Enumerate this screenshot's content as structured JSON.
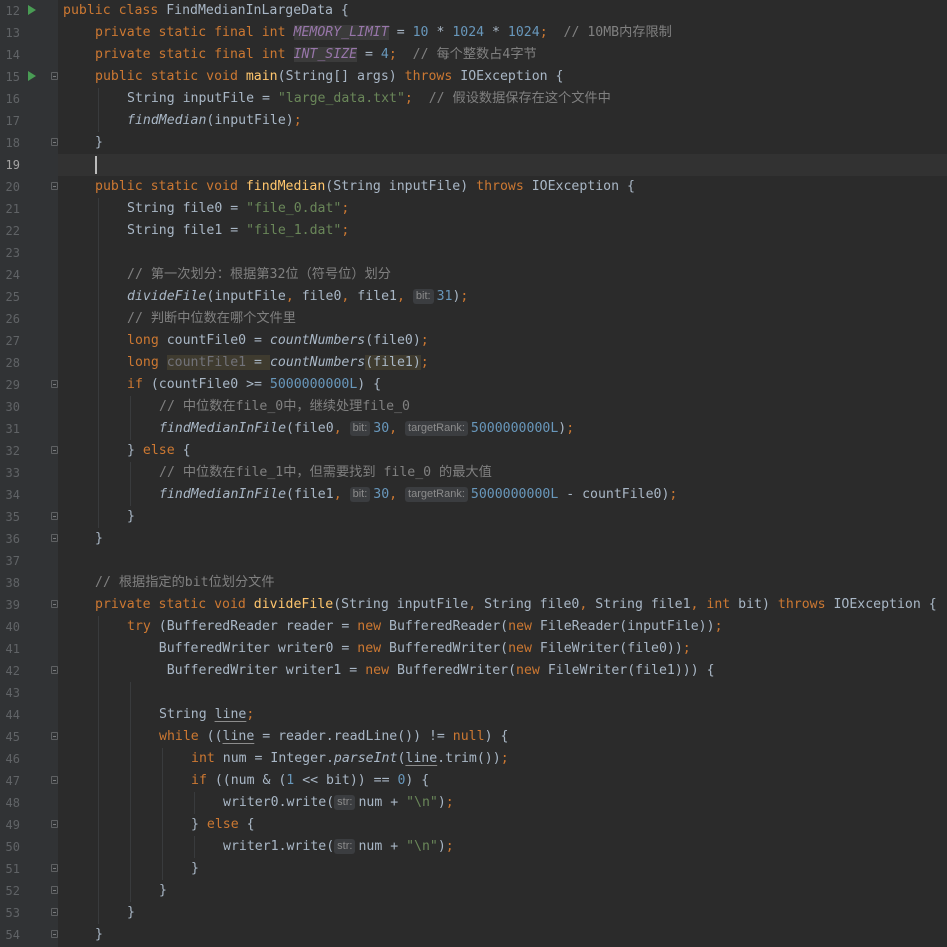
{
  "editor": {
    "language": "java",
    "current_line": 19,
    "colors": {
      "background": "#2b2b2b",
      "gutter": "#313335",
      "keyword": "#cc7832",
      "string": "#6a8759",
      "number": "#6897bb",
      "comment": "#808080",
      "constant": "#9876aa",
      "method_declaration": "#ffc66d",
      "run_icon": "#499c54"
    },
    "lines": [
      {
        "no": "12",
        "run": true,
        "fold": false,
        "indent": 0,
        "tokens": [
          [
            "kw",
            "public class "
          ],
          [
            "p",
            "FindMedianInLargeData {"
          ]
        ]
      },
      {
        "no": "13",
        "indent": 1,
        "tokens": [
          [
            "kw",
            "private static final int "
          ],
          [
            "const",
            "MEMORY_LIMIT"
          ],
          [
            "p",
            " = "
          ],
          [
            "num",
            "10"
          ],
          [
            "p",
            " * "
          ],
          [
            "num",
            "1024"
          ],
          [
            "p",
            " * "
          ],
          [
            "num",
            "1024"
          ],
          [
            "kw",
            ";"
          ],
          [
            "cmt",
            "  // 10MB内存限制"
          ]
        ]
      },
      {
        "no": "14",
        "indent": 1,
        "tokens": [
          [
            "kw",
            "private static final int "
          ],
          [
            "const",
            "INT_SIZE"
          ],
          [
            "p",
            " = "
          ],
          [
            "num",
            "4"
          ],
          [
            "kw",
            ";"
          ],
          [
            "cmt",
            "  // 每个整数占4字节"
          ]
        ]
      },
      {
        "no": "15",
        "run": true,
        "fold": true,
        "indent": 1,
        "tokens": [
          [
            "kw",
            "public static void "
          ],
          [
            "fn",
            "main"
          ],
          [
            "p",
            "(String[] args) "
          ],
          [
            "kw",
            "throws "
          ],
          [
            "p",
            "IOException {"
          ]
        ]
      },
      {
        "no": "16",
        "indent": 2,
        "tokens": [
          [
            "p",
            "String inputFile = "
          ],
          [
            "str",
            "\"large_data.txt\""
          ],
          [
            "kw",
            ";"
          ],
          [
            "cmt",
            "  // 假设数据保存在这个文件中"
          ]
        ]
      },
      {
        "no": "17",
        "indent": 2,
        "tokens": [
          [
            "sfn",
            "findMedian"
          ],
          [
            "p",
            "(inputFile)"
          ],
          [
            "kw",
            ";"
          ]
        ]
      },
      {
        "no": "18",
        "fold": true,
        "indent": 1,
        "tokens": [
          [
            "p",
            "}"
          ]
        ]
      },
      {
        "no": "19",
        "indent": 1,
        "caret": true,
        "tokens": []
      },
      {
        "no": "20",
        "fold": true,
        "indent": 1,
        "tokens": [
          [
            "kw",
            "public static void "
          ],
          [
            "fn",
            "findMedian"
          ],
          [
            "p",
            "(String inputFile) "
          ],
          [
            "kw",
            "throws "
          ],
          [
            "p",
            "IOException {"
          ]
        ]
      },
      {
        "no": "21",
        "indent": 2,
        "tokens": [
          [
            "p",
            "String file0 = "
          ],
          [
            "str",
            "\"file_0.dat\""
          ],
          [
            "kw",
            ";"
          ]
        ]
      },
      {
        "no": "22",
        "indent": 2,
        "tokens": [
          [
            "p",
            "String file1 = "
          ],
          [
            "str",
            "\"file_1.dat\""
          ],
          [
            "kw",
            ";"
          ]
        ]
      },
      {
        "no": "23",
        "indent": 2,
        "tokens": []
      },
      {
        "no": "24",
        "indent": 2,
        "tokens": [
          [
            "cmt",
            "// 第一次划分：根据第32位（符号位）划分"
          ]
        ]
      },
      {
        "no": "25",
        "indent": 2,
        "tokens": [
          [
            "sfn",
            "divideFile"
          ],
          [
            "p",
            "(inputFile"
          ],
          [
            "kw",
            ", "
          ],
          [
            "p",
            "file0"
          ],
          [
            "kw",
            ", "
          ],
          [
            "p",
            "file1"
          ],
          [
            "kw",
            ", "
          ],
          [
            "hint",
            "bit:"
          ],
          [
            "num",
            "31"
          ],
          [
            "p",
            ")"
          ],
          [
            "kw",
            ";"
          ]
        ]
      },
      {
        "no": "26",
        "indent": 2,
        "tokens": [
          [
            "cmt",
            "// 判断中位数在哪个文件里"
          ]
        ]
      },
      {
        "no": "27",
        "indent": 2,
        "tokens": [
          [
            "kw",
            "long "
          ],
          [
            "p",
            "countFile0 = "
          ],
          [
            "sfn",
            "countNumbers"
          ],
          [
            "p",
            "(file0)"
          ],
          [
            "kw",
            ";"
          ]
        ]
      },
      {
        "no": "28",
        "indent": 2,
        "tokens": [
          [
            "kw",
            "long "
          ],
          [
            "unused",
            "countFile1"
          ],
          [
            "warn",
            " = "
          ],
          [
            "sfn",
            "countNumbers"
          ],
          [
            "warn",
            "(file1)"
          ],
          [
            "kw",
            ";"
          ]
        ]
      },
      {
        "no": "29",
        "fold": true,
        "indent": 2,
        "tokens": [
          [
            "kw",
            "if "
          ],
          [
            "p",
            "(countFile0 >= "
          ],
          [
            "num",
            "5000000000L"
          ],
          [
            "p",
            ") {"
          ]
        ]
      },
      {
        "no": "30",
        "indent": 3,
        "tokens": [
          [
            "cmt",
            "// 中位数在file_0中，继续处理file_0"
          ]
        ]
      },
      {
        "no": "31",
        "indent": 3,
        "tokens": [
          [
            "sfn",
            "findMedianInFile"
          ],
          [
            "p",
            "(file0"
          ],
          [
            "kw",
            ", "
          ],
          [
            "hint",
            "bit:"
          ],
          [
            "num",
            "30"
          ],
          [
            "kw",
            ", "
          ],
          [
            "hint",
            "targetRank:"
          ],
          [
            "num",
            "5000000000L"
          ],
          [
            "p",
            ")"
          ],
          [
            "kw",
            ";"
          ]
        ]
      },
      {
        "no": "32",
        "fold": true,
        "indent": 2,
        "tokens": [
          [
            "p",
            "} "
          ],
          [
            "kw",
            "else "
          ],
          [
            "p",
            "{"
          ]
        ]
      },
      {
        "no": "33",
        "indent": 3,
        "tokens": [
          [
            "cmt",
            "// 中位数在file_1中，但需要找到 file_0 的最大值"
          ]
        ]
      },
      {
        "no": "34",
        "indent": 3,
        "tokens": [
          [
            "sfn",
            "findMedianInFile"
          ],
          [
            "p",
            "(file1"
          ],
          [
            "kw",
            ", "
          ],
          [
            "hint",
            "bit:"
          ],
          [
            "num",
            "30"
          ],
          [
            "kw",
            ", "
          ],
          [
            "hint",
            "targetRank:"
          ],
          [
            "num",
            "5000000000L"
          ],
          [
            "p",
            " - countFile0)"
          ],
          [
            "kw",
            ";"
          ]
        ]
      },
      {
        "no": "35",
        "fold": true,
        "indent": 2,
        "tokens": [
          [
            "p",
            "}"
          ]
        ]
      },
      {
        "no": "36",
        "fold": true,
        "indent": 1,
        "tokens": [
          [
            "p",
            "}"
          ]
        ]
      },
      {
        "no": "37",
        "indent": 1,
        "tokens": []
      },
      {
        "no": "38",
        "indent": 1,
        "tokens": [
          [
            "cmt",
            "// 根据指定的bit位划分文件"
          ]
        ]
      },
      {
        "no": "39",
        "fold": true,
        "indent": 1,
        "tokens": [
          [
            "kw",
            "private static void "
          ],
          [
            "fn",
            "divideFile"
          ],
          [
            "p",
            "(String inputFile"
          ],
          [
            "kw",
            ", "
          ],
          [
            "p",
            "String file0"
          ],
          [
            "kw",
            ", "
          ],
          [
            "p",
            "String file1"
          ],
          [
            "kw",
            ", int "
          ],
          [
            "p",
            "bit) "
          ],
          [
            "kw",
            "throws "
          ],
          [
            "p",
            "IOException {"
          ]
        ]
      },
      {
        "no": "40",
        "indent": 2,
        "tokens": [
          [
            "kw",
            "try "
          ],
          [
            "p",
            "(BufferedReader reader = "
          ],
          [
            "kw",
            "new "
          ],
          [
            "p",
            "BufferedReader("
          ],
          [
            "kw",
            "new "
          ],
          [
            "p",
            "FileReader(inputFile))"
          ],
          [
            "kw",
            ";"
          ]
        ]
      },
      {
        "no": "41",
        "indent": 2,
        "pad": " ",
        "tokens": [
          [
            "p",
            "    BufferedWriter writer0 = "
          ],
          [
            "kw",
            "new "
          ],
          [
            "p",
            "BufferedWriter("
          ],
          [
            "kw",
            "new "
          ],
          [
            "p",
            "FileWriter(file0))"
          ],
          [
            "kw",
            ";"
          ]
        ]
      },
      {
        "no": "42",
        "fold": true,
        "indent": 2,
        "tokens": [
          [
            "p",
            "     BufferedWriter writer1 = "
          ],
          [
            "kw",
            "new "
          ],
          [
            "p",
            "BufferedWriter("
          ],
          [
            "kw",
            "new "
          ],
          [
            "p",
            "FileWriter(file1))) {"
          ]
        ]
      },
      {
        "no": "43",
        "indent": 3,
        "tokens": []
      },
      {
        "no": "44",
        "indent": 3,
        "tokens": [
          [
            "p",
            "String "
          ],
          [
            "u",
            "line"
          ],
          [
            "kw",
            ";"
          ]
        ]
      },
      {
        "no": "45",
        "fold": true,
        "indent": 3,
        "tokens": [
          [
            "kw",
            "while "
          ],
          [
            "p",
            "(("
          ],
          [
            "u",
            "line"
          ],
          [
            "p",
            " = reader.readLine()) != "
          ],
          [
            "kw",
            "null"
          ],
          [
            "p",
            ") {"
          ]
        ]
      },
      {
        "no": "46",
        "indent": 4,
        "tokens": [
          [
            "kw",
            "int "
          ],
          [
            "p",
            "num = Integer."
          ],
          [
            "sfn",
            "parseInt"
          ],
          [
            "p",
            "("
          ],
          [
            "u",
            "line"
          ],
          [
            "p",
            ".trim())"
          ],
          [
            "kw",
            ";"
          ]
        ]
      },
      {
        "no": "47",
        "fold": true,
        "indent": 4,
        "tokens": [
          [
            "kw",
            "if "
          ],
          [
            "p",
            "((num & ("
          ],
          [
            "num",
            "1"
          ],
          [
            "p",
            " << bit)) == "
          ],
          [
            "num",
            "0"
          ],
          [
            "p",
            ") {"
          ]
        ]
      },
      {
        "no": "48",
        "indent": 5,
        "tokens": [
          [
            "p",
            "writer0.write("
          ],
          [
            "hint",
            "str:"
          ],
          [
            "p",
            "num + "
          ],
          [
            "str",
            "\"\\n\""
          ],
          [
            "p",
            ")"
          ],
          [
            "kw",
            ";"
          ]
        ]
      },
      {
        "no": "49",
        "fold": true,
        "indent": 4,
        "tokens": [
          [
            "p",
            "} "
          ],
          [
            "kw",
            "else "
          ],
          [
            "p",
            "{"
          ]
        ]
      },
      {
        "no": "50",
        "indent": 5,
        "tokens": [
          [
            "p",
            "writer1.write("
          ],
          [
            "hint",
            "str:"
          ],
          [
            "p",
            "num + "
          ],
          [
            "str",
            "\"\\n\""
          ],
          [
            "p",
            ")"
          ],
          [
            "kw",
            ";"
          ]
        ]
      },
      {
        "no": "51",
        "fold": true,
        "indent": 4,
        "tokens": [
          [
            "p",
            "}"
          ]
        ]
      },
      {
        "no": "52",
        "fold": true,
        "indent": 3,
        "tokens": [
          [
            "p",
            "}"
          ]
        ]
      },
      {
        "no": "53",
        "fold": true,
        "indent": 2,
        "tokens": [
          [
            "p",
            "}"
          ]
        ]
      },
      {
        "no": "54",
        "fold": true,
        "indent": 1,
        "tokens": [
          [
            "p",
            "}"
          ]
        ]
      }
    ]
  }
}
